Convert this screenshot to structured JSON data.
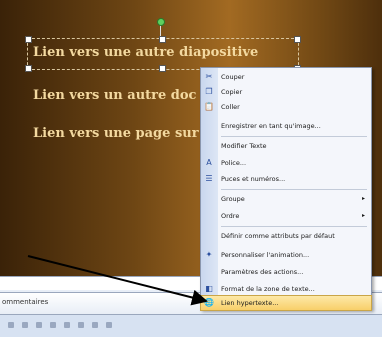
{
  "slide": {
    "line1": "Lien vers une autre diapositive",
    "line2": "Lien vers un autre doc",
    "line3": "Lien vers une page sur"
  },
  "comment_bar": {
    "placeholder": "ommentaires"
  },
  "context_menu": {
    "items": [
      {
        "label": "Couper",
        "icon": "cut-icon"
      },
      {
        "label": "Copier",
        "icon": "copy-icon"
      },
      {
        "label": "Coller",
        "icon": "paste-icon"
      },
      {
        "label": "Enregistrer en tant qu'image...",
        "icon": ""
      },
      {
        "label": "Modifier Texte",
        "icon": ""
      },
      {
        "label": "Police...",
        "icon": "font-icon"
      },
      {
        "label": "Puces et numéros...",
        "icon": "bullets-icon"
      },
      {
        "label": "Groupe",
        "icon": "",
        "submenu": "▸"
      },
      {
        "label": "Ordre",
        "icon": "",
        "submenu": "▸"
      },
      {
        "label": "Définir comme attributs par défaut",
        "icon": ""
      },
      {
        "label": "Personnaliser l'animation...",
        "icon": "animation-icon"
      },
      {
        "label": "Paramètres des actions...",
        "icon": ""
      },
      {
        "label": "Format de la zone de texte...",
        "icon": "format-icon"
      },
      {
        "label": "Lien hypertexte...",
        "icon": "hyperlink-icon"
      }
    ]
  },
  "colors": {
    "highlight": "#f8cf6a",
    "slide_text": "#f3d9a0"
  }
}
